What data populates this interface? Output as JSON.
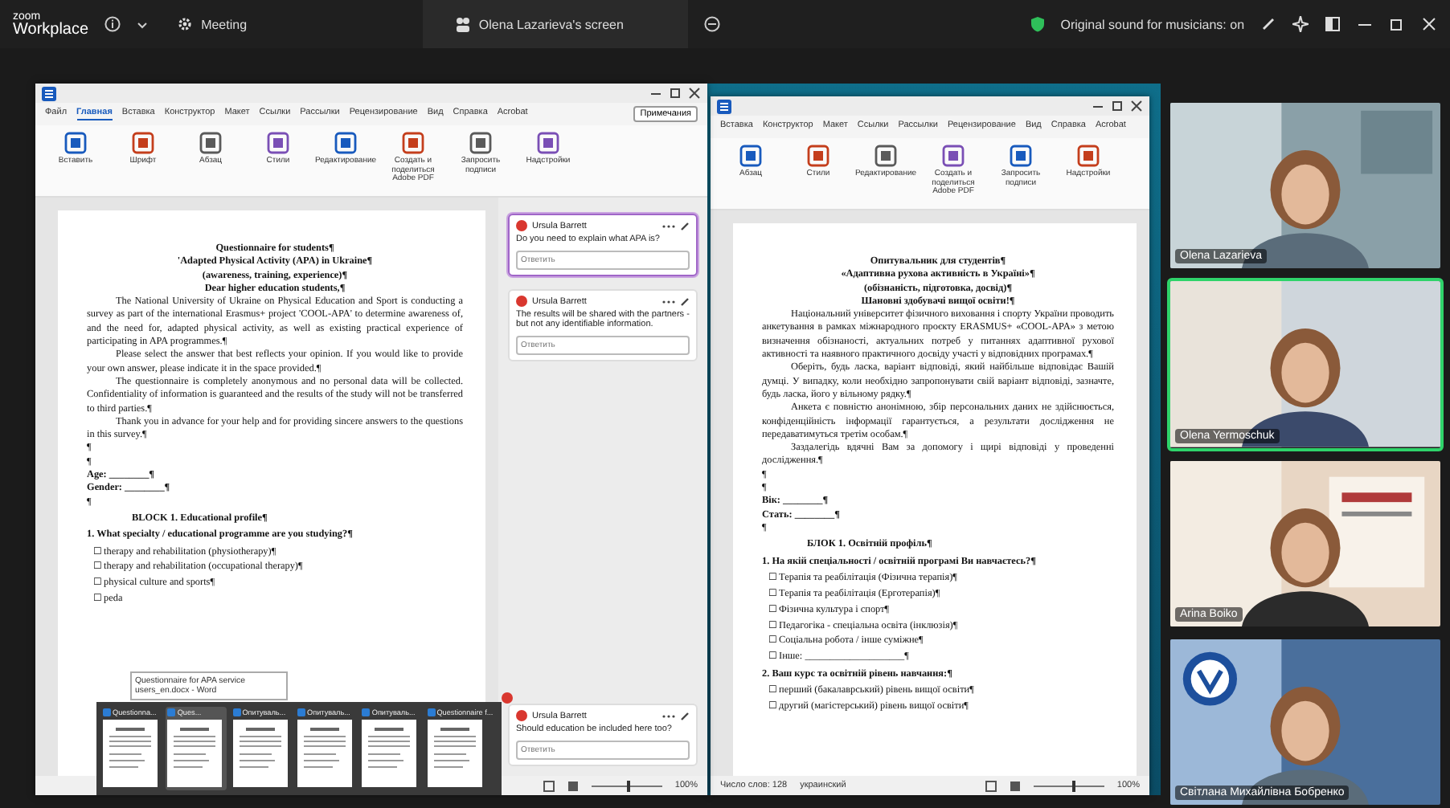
{
  "topbar": {
    "brand": "zoom",
    "product": "Workplace",
    "meeting": "Meeting",
    "share": "Olena Lazarieva's screen",
    "sound": "Original sound for musicians: on"
  },
  "left_window": {
    "tabs": [
      {
        "label": "Файл",
        "selected": false
      },
      {
        "label": "Главная",
        "selected": true
      },
      {
        "label": "Вставка",
        "selected": false
      },
      {
        "label": "Конструктор",
        "selected": false
      },
      {
        "label": "Макет",
        "selected": false
      },
      {
        "label": "Ссылки",
        "selected": false
      },
      {
        "label": "Рассылки",
        "selected": false
      },
      {
        "label": "Рецензирование",
        "selected": false
      },
      {
        "label": "Вид",
        "selected": false
      },
      {
        "label": "Справка",
        "selected": false
      },
      {
        "label": "Acrobat",
        "selected": false
      }
    ],
    "notes_button": "Примечания",
    "ribbon": [
      "Вставить",
      "Шрифт",
      "Абзац",
      "Стили",
      "Редактирование",
      "Создать и поделиться Adobe PDF",
      "Запросить подписи",
      "Надстройки"
    ],
    "document": [
      {
        "kind": "title",
        "text": "Questionnaire for students¶"
      },
      {
        "kind": "title",
        "text": "'Adapted Physical Activity (APA) in Ukraine¶"
      },
      {
        "kind": "title",
        "text": "(awareness, training, experience)¶"
      },
      {
        "kind": "title",
        "text": "Dear higher education students,¶"
      },
      {
        "kind": "para",
        "text": "The National University of Ukraine on Physical Education and Sport is conducting a survey as part of the international Erasmus+ project 'COOL-APA' to determine awareness of, and the need for, adapted physical activity, as well as existing practical experience of participating in APA programmes.¶"
      },
      {
        "kind": "para",
        "text": "Please select the answer that best reflects your opinion. If you would like to provide your own answer, please indicate it in the space provided.¶"
      },
      {
        "kind": "para",
        "text": "The questionnaire is completely anonymous and no personal data will be collected. Confidentiality of information is guaranteed and the results of the study will not be transferred to third parties.¶"
      },
      {
        "kind": "para",
        "text": "Thank you in advance for your help and for providing sincere answers to the questions in this survey.¶"
      },
      {
        "kind": "blank",
        "text": "¶"
      },
      {
        "kind": "blank",
        "text": "¶"
      },
      {
        "kind": "field",
        "text": "Age: ________¶"
      },
      {
        "kind": "field",
        "text": "Gender: ________¶"
      },
      {
        "kind": "blank",
        "text": "¶"
      },
      {
        "kind": "heading",
        "text": "BLOCK 1. Educational profile¶"
      },
      {
        "kind": "question",
        "text": "1. What specialty / educational programme are you studying?¶"
      },
      {
        "kind": "option",
        "text": "☐ therapy and rehabilitation (physiotherapy)¶"
      },
      {
        "kind": "option",
        "text": "☐ therapy and rehabilitation (occupational therapy)¶"
      },
      {
        "kind": "option",
        "text": "☐ physical culture and sports¶"
      },
      {
        "kind": "option",
        "text": "☐ peda"
      }
    ],
    "comments": [
      {
        "author": "Ursula Barrett",
        "text": "Do you need to explain what APA is?",
        "reply_placeholder": "Ответить",
        "selected": true
      },
      {
        "author": "Ursula Barrett",
        "text": "The results will be shared with the partners - but not any identifiable information.",
        "reply_placeholder": "Ответить",
        "selected": false
      },
      {
        "author": "Ursula Barrett",
        "text": "Should education be included here too?",
        "reply_placeholder": "Ответить",
        "selected": false
      }
    ],
    "status": {
      "zoom": "100%",
      "zoom_slider": {
        "level": 0.5
      }
    },
    "tooltip": "Questionnaire for APA service users_en.docx - Word"
  },
  "right_window": {
    "tabs": [
      {
        "label": "Вставка",
        "selected": false
      },
      {
        "label": "Конструктор",
        "selected": false
      },
      {
        "label": "Макет",
        "selected": false
      },
      {
        "label": "Ссылки",
        "selected": false
      },
      {
        "label": "Рассылки",
        "selected": false
      },
      {
        "label": "Рецензирование",
        "selected": false
      },
      {
        "label": "Вид",
        "selected": false
      },
      {
        "label": "Справка",
        "selected": false
      },
      {
        "label": "Acrobat",
        "selected": false
      }
    ],
    "ribbon": [
      "Абзац",
      "Стили",
      "Редактирование",
      "Создать и поделиться Adobe PDF",
      "Запросить подписи",
      "Надстройки"
    ],
    "document": [
      {
        "kind": "title",
        "text": "Опитувальник для студентів¶"
      },
      {
        "kind": "title",
        "text": "«Адаптивна рухова активність в Україні»¶"
      },
      {
        "kind": "title",
        "text": "(обізнаність, підготовка, досвід)¶"
      },
      {
        "kind": "title",
        "text": "Шановні здобувачі вищої освіти!¶"
      },
      {
        "kind": "para",
        "text": "Національний університет фізичного виховання і спорту України проводить анкетування в рамках міжнародного проєкту ERASMUS+ «COOL-APA» з метою визначення обізнаності, актуальних потреб у питаннях адаптивної рухової активності та наявного практичного досвіду участі у відповідних програмах.¶"
      },
      {
        "kind": "para",
        "text": "Оберіть, будь ласка, варіант відповіді, який найбільше відповідає Вашій думці. У випадку, коли необхідно запропонувати свій варіант відповіді, зазначте, будь ласка, його у вільному рядку.¶"
      },
      {
        "kind": "para",
        "text": "Анкета є повністю анонімною, збір персональних даних не здійснюється, конфіденційність інформації гарантується, а результати дослідження не передаватимуться третім особам.¶"
      },
      {
        "kind": "para",
        "text": "Заздалегідь вдячні Вам за допомогу і щирі відповіді у проведенні дослідження.¶"
      },
      {
        "kind": "blank",
        "text": "¶"
      },
      {
        "kind": "blank",
        "text": "¶"
      },
      {
        "kind": "field",
        "text": "Вік: ________¶"
      },
      {
        "kind": "field",
        "text": "Стать: ________¶"
      },
      {
        "kind": "blank",
        "text": "¶"
      },
      {
        "kind": "heading",
        "text": "БЛОК 1. Освітній профіль¶"
      },
      {
        "kind": "question",
        "text": "1. На якій спеціальності / освітній програмі Ви навчаєтесь?¶"
      },
      {
        "kind": "option",
        "text": "☐ Терапія та реабілітація (Фізична терапія)¶"
      },
      {
        "kind": "option",
        "text": "☐ Терапія та реабілітація (Ерготерапія)¶"
      },
      {
        "kind": "option",
        "text": "☐ Фізична культура і спорт¶"
      },
      {
        "kind": "option",
        "text": "☐ Педагогіка - спеціальна освіта (інклюзія)¶"
      },
      {
        "kind": "option",
        "text": "☐ Соціальна робота / інше суміжне¶"
      },
      {
        "kind": "option",
        "text": "☐ Інше: ____________________¶"
      },
      {
        "kind": "question",
        "text": "2. Ваш курс та освітній рівень навчання:¶"
      },
      {
        "kind": "option",
        "text": "☐ перший (бакалаврський) рівень вищої освіти¶"
      },
      {
        "kind": "option",
        "text": "☐ другий (магістерський) рівень вищої освіти¶"
      }
    ],
    "status": {
      "words": "Число слов: 128",
      "language": "украинский",
      "zoom": "100%",
      "zoom_slider": {
        "level": 0.55
      }
    }
  },
  "taskbar_previews": [
    {
      "title": "Questionna...",
      "selected": false
    },
    {
      "title": "Ques...",
      "selected": true
    },
    {
      "title": "Опитуваль...",
      "selected": false
    },
    {
      "title": "Опитуваль...",
      "selected": false
    },
    {
      "title": "Опитуваль...",
      "selected": false
    },
    {
      "title": "Questionnaire f...",
      "selected": false
    }
  ],
  "participants": [
    {
      "name": "Olena Lazarieva",
      "active_speaker": false
    },
    {
      "name": "Olena Yermoschuk",
      "active_speaker": true
    },
    {
      "name": "Arina Boiko",
      "active_speaker": false
    },
    {
      "name": "Світлана Михайлівна Бобренко",
      "active_speaker": false
    }
  ]
}
